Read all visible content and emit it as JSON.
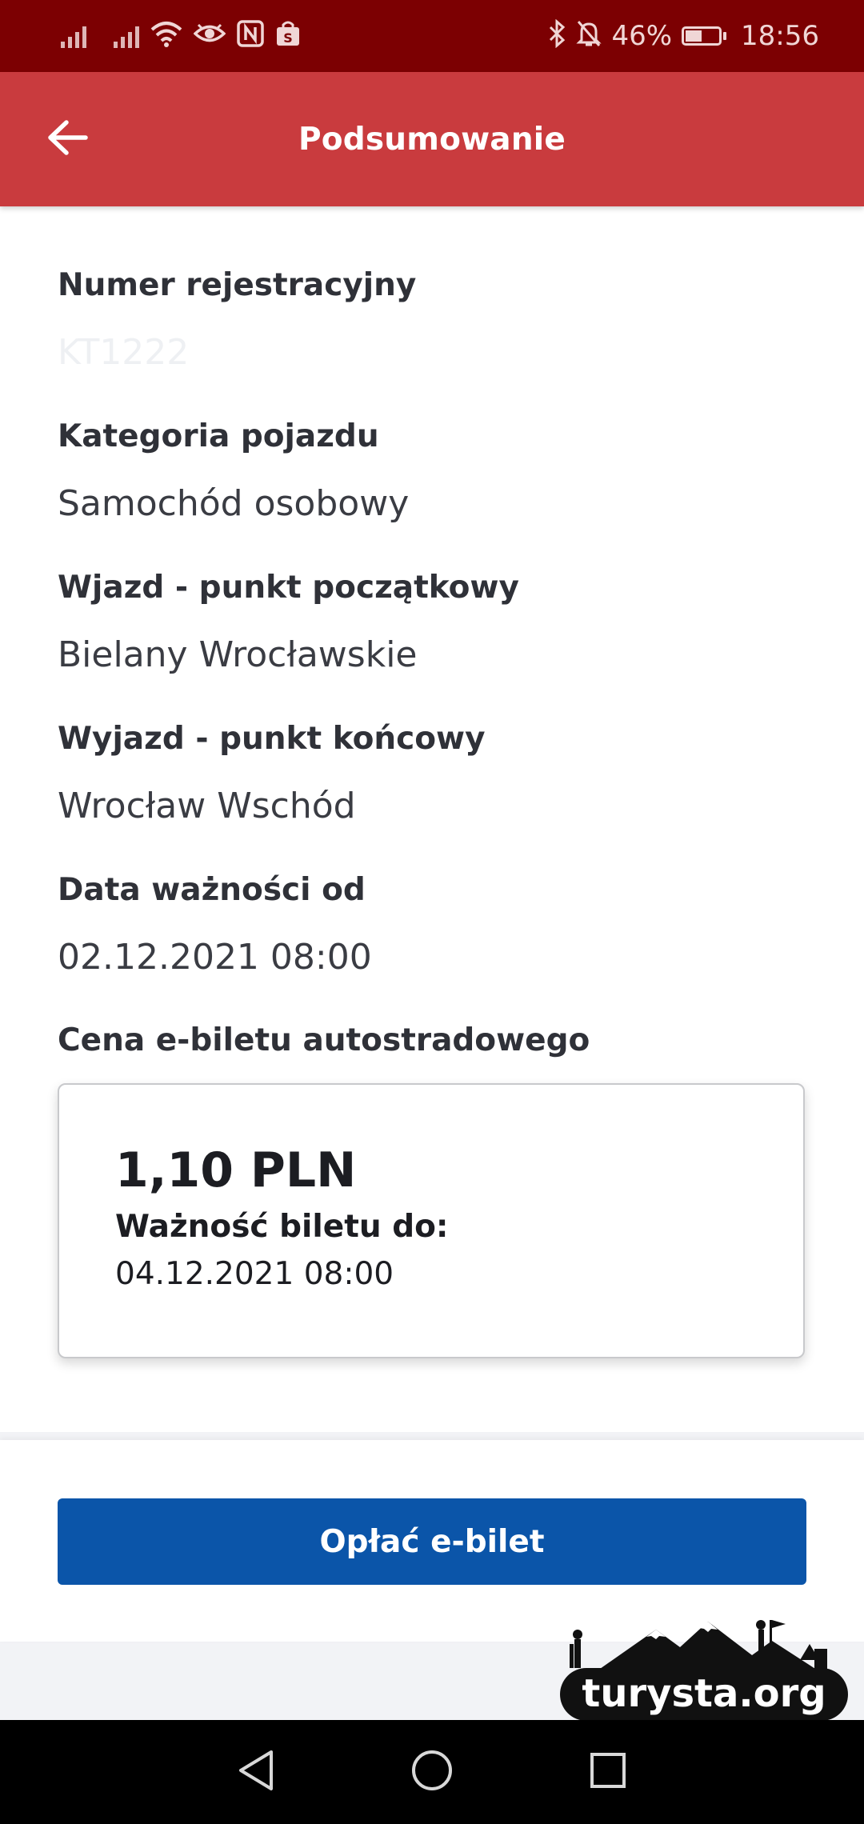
{
  "status_bar": {
    "battery_percent_text": "46%",
    "battery_level": 0.46,
    "time": "18:56",
    "icons": [
      "signal-icon",
      "signal-icon",
      "wifi-icon",
      "eye-icon",
      "nfc-icon",
      "shopping-bag-icon",
      "bluetooth-icon",
      "bell-muted-icon",
      "battery-icon"
    ]
  },
  "app_bar": {
    "title": "Podsumowanie",
    "back_icon": "arrow-left-icon",
    "color": "#c93b3e"
  },
  "summary": {
    "registration": {
      "label": "Numer rejestracyjny",
      "value": "KT1222"
    },
    "vehicle_category": {
      "label": "Kategoria pojazdu",
      "value": "Samochód osobowy"
    },
    "entry_point": {
      "label": "Wjazd - punkt początkowy",
      "value": "Bielany Wrocławskie"
    },
    "exit_point": {
      "label": "Wyjazd - punkt końcowy",
      "value": "Wrocław Wschód"
    },
    "valid_from": {
      "label": "Data ważności od",
      "value": "02.12.2021 08:00"
    }
  },
  "price": {
    "label": "Cena e-biletu autostradowego",
    "amount": "1,10 PLN",
    "validity_label": "Ważność biletu do:",
    "validity_value": "04.12.2021 08:00"
  },
  "actions": {
    "pay_label": "Opłać e-bilet",
    "pay_color": "#0b55a9"
  },
  "watermark": {
    "text": "turysta.org"
  },
  "nav_bar": {
    "icons": [
      "back-triangle-icon",
      "home-circle-icon",
      "recents-square-icon"
    ]
  }
}
